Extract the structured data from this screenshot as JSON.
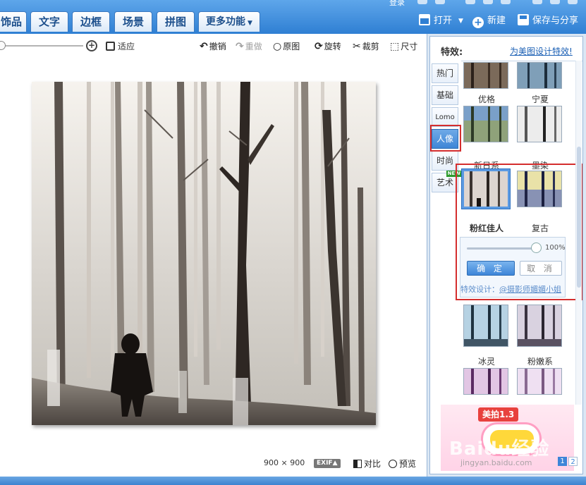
{
  "nav": {
    "tabs": [
      {
        "label": "饰品"
      },
      {
        "label": "文字"
      },
      {
        "label": "边框"
      },
      {
        "label": "场景"
      },
      {
        "label": "拼图"
      },
      {
        "label": "更多功能"
      }
    ],
    "top_text": "登录",
    "open_label": "打开",
    "new_label": "新建",
    "save_label": "保存与分享"
  },
  "toolbar": {
    "fit_label": "适应",
    "undo_label": "撤销",
    "redo_label": "重做",
    "original_label": "原图",
    "rotate_label": "旋转",
    "crop_label": "裁剪",
    "resize_label": "尺寸",
    "zoom_level": 0
  },
  "canvas": {
    "image_size": "900 × 900",
    "exif_label": "EXIF▲",
    "compare_label": "对比",
    "preview_label": "预览"
  },
  "panel": {
    "title": "特效:",
    "design_link": "为美图设计特效!",
    "categories": [
      {
        "label": "热门"
      },
      {
        "label": "基础"
      },
      {
        "label": "Lomo"
      },
      {
        "label": "人像",
        "selected": true
      },
      {
        "label": "时尚"
      },
      {
        "label": "艺术",
        "badge": "NEW"
      }
    ],
    "effects": [
      {
        "label": "优格"
      },
      {
        "label": "宁夏"
      },
      {
        "label": "新日系"
      },
      {
        "label": "墨染"
      },
      {
        "label": "粉红佳人",
        "selected": true
      },
      {
        "label": "复古"
      },
      {
        "label": "冰灵"
      },
      {
        "label": "粉嫩系"
      }
    ],
    "options": {
      "intensity": "100%",
      "confirm_label": "确 定",
      "cancel_label": "取 消",
      "designer_prefix": "特效设计：",
      "designer_name": "@摄影师媚媚小姐"
    },
    "ad": {
      "badge": "美拍1.3",
      "watermark": "Baidu经验",
      "url": "jingyan.baidu.com"
    },
    "pages": [
      "1",
      "2"
    ]
  },
  "colors": {
    "accent": "#3d85d8",
    "highlight": "#d42e2e",
    "topbar": "#2f7fd3"
  }
}
